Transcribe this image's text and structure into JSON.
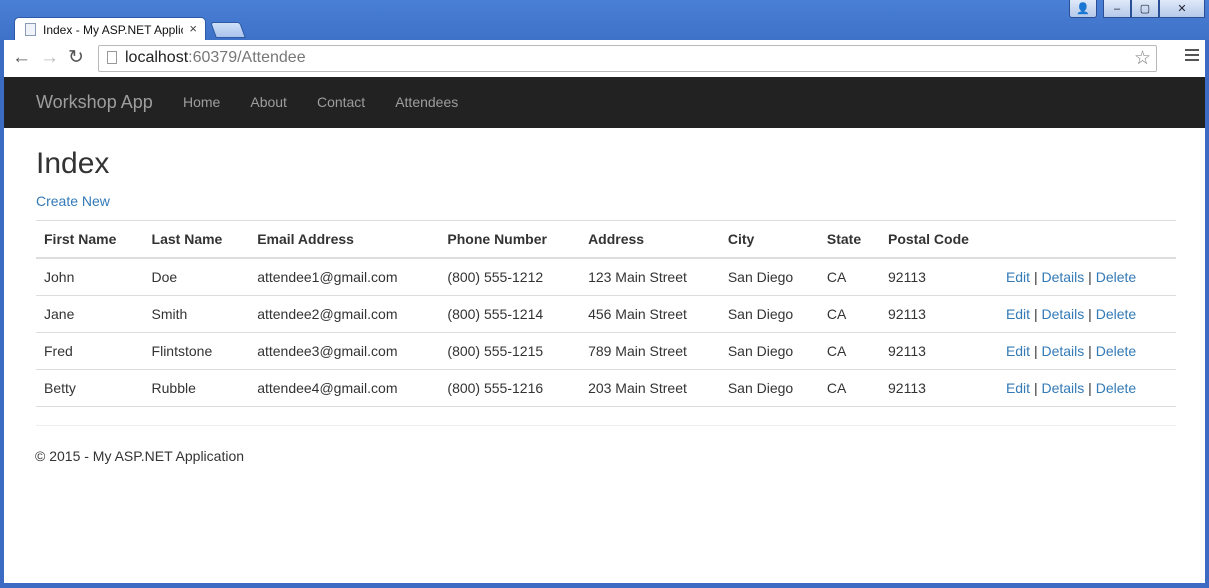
{
  "browser": {
    "tab_title": "Index - My ASP.NET Application",
    "tab_close": "×",
    "url_host": "localhost",
    "url_rest": ":60379/Attendee",
    "win_user": "👤",
    "win_min": "–",
    "win_max": "▢",
    "win_close": "✕",
    "back": "←",
    "forward": "→",
    "reload": "↻",
    "star": "☆"
  },
  "navbar": {
    "brand": "Workshop App",
    "links": [
      "Home",
      "About",
      "Contact",
      "Attendees"
    ]
  },
  "page": {
    "title": "Index",
    "create_new": "Create New"
  },
  "table": {
    "headers": [
      "First Name",
      "Last Name",
      "Email Address",
      "Phone Number",
      "Address",
      "City",
      "State",
      "Postal Code"
    ],
    "rows": [
      [
        "John",
        "Doe",
        "attendee1@gmail.com",
        "(800) 555-1212",
        "123 Main Street",
        "San Diego",
        "CA",
        "92113"
      ],
      [
        "Jane",
        "Smith",
        "attendee2@gmail.com",
        "(800) 555-1214",
        "456 Main Street",
        "San Diego",
        "CA",
        "92113"
      ],
      [
        "Fred",
        "Flintstone",
        "attendee3@gmail.com",
        "(800) 555-1215",
        "789 Main Street",
        "San Diego",
        "CA",
        "92113"
      ],
      [
        "Betty",
        "Rubble",
        "attendee4@gmail.com",
        "(800) 555-1216",
        "203 Main Street",
        "San Diego",
        "CA",
        "92113"
      ]
    ],
    "actions": {
      "edit": "Edit",
      "details": "Details",
      "delete": "Delete",
      "separator": "|"
    }
  },
  "footer": {
    "text": "© 2015 - My ASP.NET Application"
  }
}
